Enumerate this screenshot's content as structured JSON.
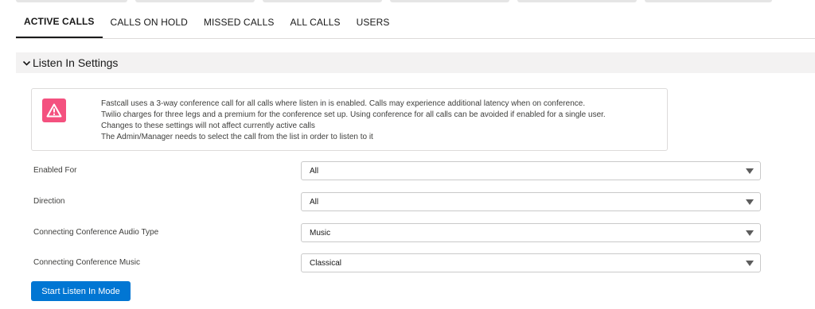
{
  "tabs": [
    {
      "label": "ACTIVE CALLS",
      "active": true
    },
    {
      "label": "CALLS ON HOLD",
      "active": false
    },
    {
      "label": "MISSED CALLS",
      "active": false
    },
    {
      "label": "ALL CALLS",
      "active": false
    },
    {
      "label": "USERS",
      "active": false
    }
  ],
  "section": {
    "title": "Listen In Settings",
    "icon": "chevron-down-icon"
  },
  "alert": {
    "icon": "warning-icon",
    "icon_color": "#f4517f",
    "lines": [
      "Fastcall uses a 3-way conference call for all calls where listen in is enabled. Calls may experience additional latency when on conference.",
      "Twilio charges for three legs and a premium for the conference set up. Using conference for all calls can be avoided if enabled for a single user.",
      "Changes to these settings will not affect currently active calls",
      "The Admin/Manager needs to select the call from the list in order to listen to it"
    ]
  },
  "fields": [
    {
      "label": "Enabled For",
      "value": "All"
    },
    {
      "label": "Direction",
      "value": "All"
    },
    {
      "label": "Connecting Conference Audio Type",
      "value": "Music"
    },
    {
      "label": "Connecting Conference Music",
      "value": "Classical"
    }
  ],
  "button": {
    "label": "Start Listen In Mode",
    "color": "#0176d3"
  }
}
